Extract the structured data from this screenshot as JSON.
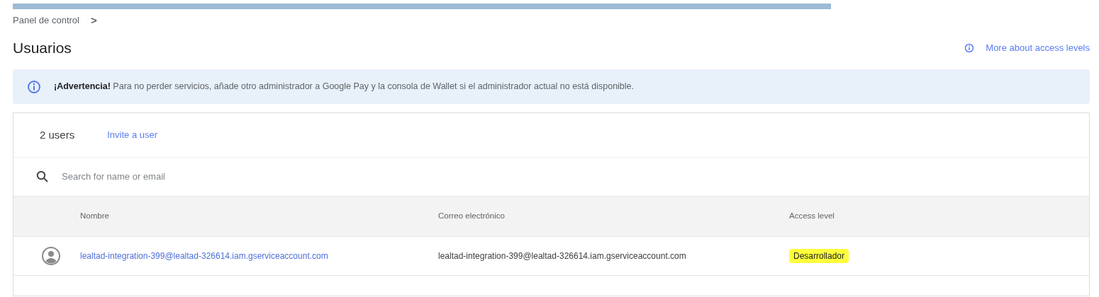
{
  "breadcrumb": {
    "items": [
      "Panel de control"
    ],
    "separator": ">"
  },
  "title": "Usuarios",
  "help_link": "More about access levels",
  "alert": {
    "text": "**¡Advertencia!** Para no perder servicios, añade otro administrador a Google Pay y la consola de Wallet si el administrador actual no está disponible."
  },
  "users_panel": {
    "count": "2 users",
    "invite_link": "Invite a user",
    "search": {
      "placeholder": "Search for name or email"
    },
    "table": {
      "columns": [
        "Nombre",
        "Correo electrónico",
        "Access level"
      ],
      "rows": [
        {
          "name": "lealtad-integration-399@lealtad-326614.iam.gserviceaccount.com",
          "email": "lealtad-integration-399@lealtad-326614.iam.gserviceaccount.com",
          "access_level": "Desarrollador",
          "highlighted": true
        }
      ]
    }
  }
}
